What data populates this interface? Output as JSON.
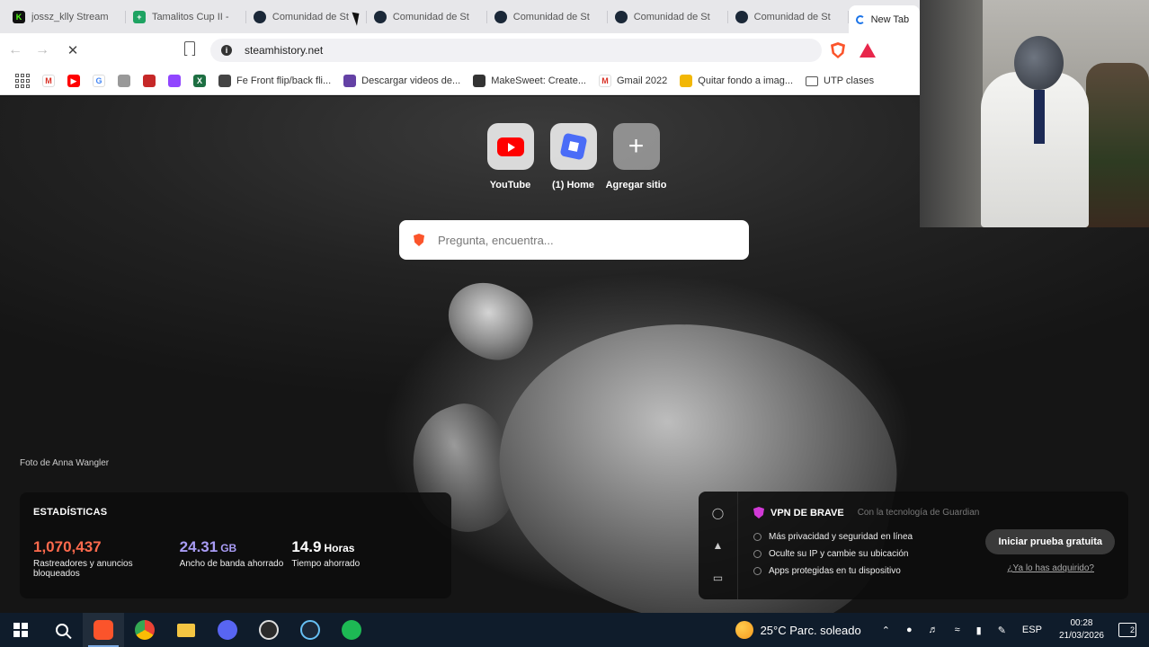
{
  "tabs": [
    {
      "title": "jossz_klly Stream",
      "icon": "kick-icon",
      "fav": "K"
    },
    {
      "title": "Tamalitos Cup II -",
      "icon": "sheets-icon",
      "fav": "+"
    },
    {
      "title": "Comunidad de St",
      "icon": "steam-icon",
      "fav": ""
    },
    {
      "title": "Comunidad de St",
      "icon": "steam-icon",
      "fav": ""
    },
    {
      "title": "Comunidad de St",
      "icon": "steam-icon",
      "fav": ""
    },
    {
      "title": "Comunidad de St",
      "icon": "steam-icon",
      "fav": ""
    },
    {
      "title": "Comunidad de St",
      "icon": "steam-icon",
      "fav": ""
    },
    {
      "title": "New Tab",
      "icon": "loading-icon",
      "fav": ""
    }
  ],
  "address": {
    "url": "steamhistory.net"
  },
  "bookmarks": [
    {
      "label": "Fe Front flip/back fli...",
      "icon": "bookmark-page-icon",
      "color": "#444444"
    },
    {
      "label": "Descargar videos de...",
      "icon": "twitch-downloader-icon",
      "color": "#6441a5"
    },
    {
      "label": "MakeSweet: Create...",
      "icon": "makesweet-icon",
      "color": "#333333"
    },
    {
      "label": "Gmail 2022",
      "icon": "gmail-icon",
      "color": "#d93025"
    },
    {
      "label": "Quitar fondo a imag...",
      "icon": "removebg-icon",
      "color": "#f2b705"
    },
    {
      "label": "UTP clases",
      "icon": "folder-icon",
      "color": "#555555"
    }
  ],
  "shortcuts": [
    {
      "label": "YouTube",
      "icon": "youtube-icon"
    },
    {
      "label": "(1) Home",
      "icon": "roblox-icon"
    },
    {
      "label": "Agregar sitio",
      "icon": "plus-icon"
    }
  ],
  "search": {
    "placeholder": "Pregunta, encuentra..."
  },
  "photo_credit": "Foto de Anna Wangler",
  "stats": {
    "title": "ESTADÍSTICAS",
    "trackers": {
      "value": "1,070,437",
      "label": "Rastreadores y anuncios bloqueados"
    },
    "bandwidth": {
      "value": "24.31",
      "unit": "GB",
      "label": "Ancho de banda ahorrado"
    },
    "time": {
      "value": "14.9",
      "unit": "Horas",
      "label": "Tiempo ahorrado"
    }
  },
  "vpn": {
    "title": "VPN DE BRAVE",
    "powered_by": "Con la tecnología de Guardian",
    "features": [
      "Más privacidad y seguridad en línea",
      "Oculte su IP y cambie su ubicación",
      "Apps protegidas en tu dispositivo"
    ],
    "cta": "Iniciar prueba gratuita",
    "link": "¿Ya lo has adquirido?"
  },
  "taskbar": {
    "weather": "25°C  Parc. soleado",
    "language": "ESP",
    "time": "00:28",
    "date": "21/03/2026",
    "notifications": "2"
  },
  "colors": {
    "brave_orange": "#fb542b",
    "trackers_value": "#ff6a4d",
    "bandwidth_value": "#a99cf5",
    "taskbar_bg": "#0f1c2b"
  }
}
